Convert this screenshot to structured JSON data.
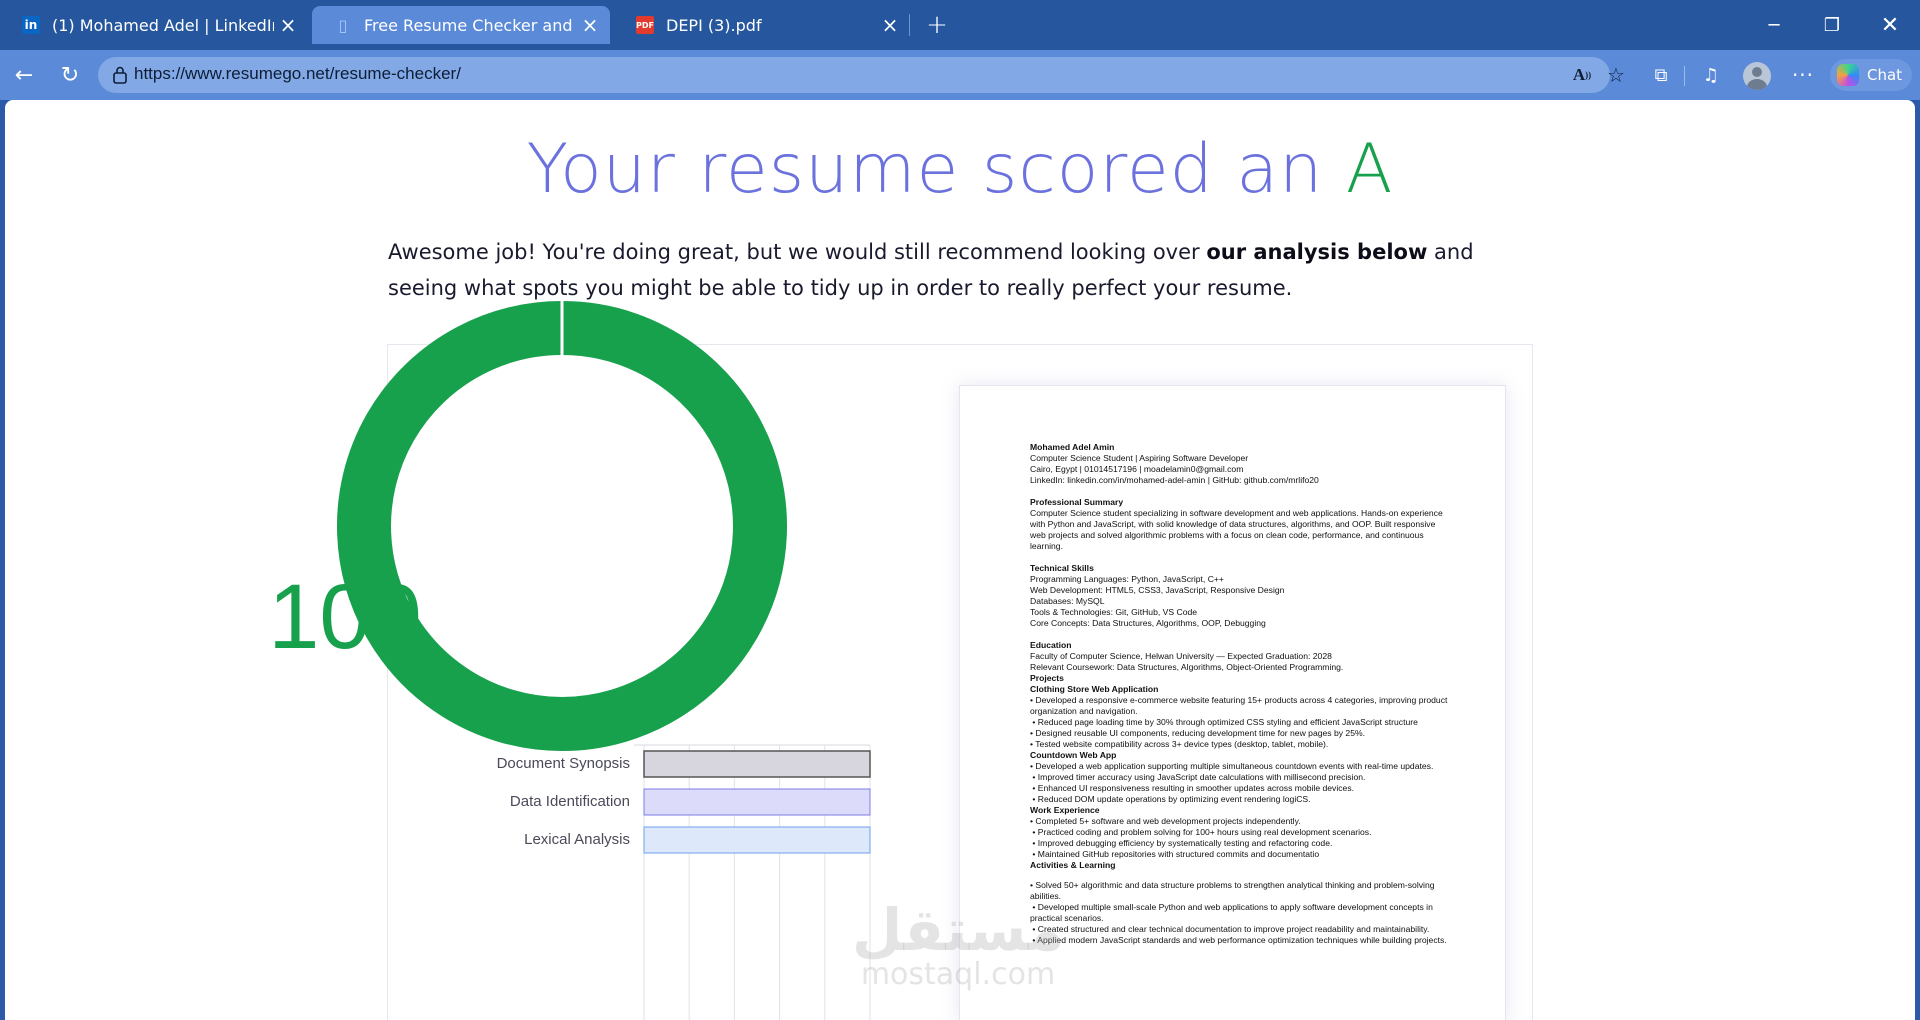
{
  "browser": {
    "tabs": [
      {
        "title": "(1) Mohamed Adel | LinkedIn",
        "icon": "linkedin-icon",
        "active": false
      },
      {
        "title": "Free Resume Checker and Scanner",
        "icon": "resumego-icon",
        "active": true
      },
      {
        "title": "DEPI (3).pdf",
        "icon": "pdf-icon",
        "active": false
      }
    ],
    "address_scheme": "https://",
    "address_host": "www.resumego.net",
    "address_path": "/resume-checker/",
    "chat_label": "Chat"
  },
  "page": {
    "headline": "Your resume scored an",
    "grade": "A",
    "intro_before": "Awesome job! You're doing great, but we would still recommend looking over ",
    "intro_bold": "our analysis below",
    "intro_after": " and seeing what spots you might be able to tidy up in order to really perfect your resume.",
    "score": "100",
    "score_value": 100,
    "colors": {
      "accent": "#6b72dd",
      "success": "#18a14c"
    },
    "bars": [
      {
        "label": "Document Synopsis",
        "fill": "#d7d6df",
        "stroke": "#555555"
      },
      {
        "label": "Data Identification",
        "fill": "#dcdcfa",
        "stroke": "#7b7be8"
      },
      {
        "label": "Lexical Analysis",
        "fill": "#dde9fb",
        "stroke": "#6aa0ee"
      }
    ]
  },
  "resume": {
    "name": "Mohamed Adel Amin",
    "headline": "Computer Science Student | Aspiring Software Developer",
    "contact": "Cairo, Egypt | 01014517196 | moadelamin0@gmail.com",
    "links": "LinkedIn: linkedin.com/in/mohamed-adel-amin | GitHub: github.com/mrlifo20",
    "summary_title": "Professional Summary",
    "summary": "Computer Science student specializing in software development and web applications. Hands-on experience with Python and JavaScript, with solid knowledge of data structures, algorithms, and OOP. Built responsive web projects and solved algorithmic problems with a focus on clean code, performance, and continuous learning.",
    "skills_title": "Technical Skills",
    "skills": [
      "Programming Languages: Python, JavaScript, C++",
      "Web Development: HTML5, CSS3, JavaScript, Responsive Design",
      "Databases: MySQL",
      "Tools & Technologies: Git, GitHub, VS Code",
      "Core Concepts: Data Structures, Algorithms, OOP, Debugging"
    ],
    "education_title": "Education",
    "education": [
      "Faculty of Computer Science, Helwan University — Expected Graduation: 2028",
      "Relevant Coursework: Data Structures, Algorithms, Object-Oriented Programming."
    ],
    "projects_title": "Projects",
    "project1_title": "Clothing Store Web Application",
    "project1": [
      "• Developed a responsive e-commerce website featuring 15+ products across 4 categories, improving product organization and navigation.",
      " • Reduced page loading time by 30% through optimized CSS styling and efficient JavaScript structure",
      "• Designed reusable UI components, reducing development time for new pages by 25%.",
      "• Tested website compatibility across 3+ device types (desktop, tablet, mobile)."
    ],
    "project2_title": "Countdown Web App",
    "project2": [
      "• Developed a web application supporting multiple simultaneous countdown events with real-time updates.",
      " • Improved timer accuracy using JavaScript date calculations with millisecond precision.",
      " • Enhanced UI responsiveness resulting in smoother updates across mobile devices.",
      " • Reduced DOM update operations by optimizing event rendering logiCS."
    ],
    "work_title": "Work Experience",
    "work": [
      "• Completed 5+ software and web development projects independently.",
      " • Practiced coding and problem solving for 100+ hours using real development scenarios.",
      " • Improved debugging efficiency by systematically testing and refactoring code.",
      " • Maintained GitHub repositories with structured commits and documentatio"
    ],
    "activities_title": "Activities & Learning",
    "activities": [
      "• Solved 50+ algorithmic and data structure problems to strengthen analytical thinking and problem-solving abilities.",
      " • Developed multiple small-scale Python and web applications to apply software development concepts in practical scenarios.",
      " • Created structured and clear technical documentation to improve project readability and maintainability.",
      " • Applied modern JavaScript standards and web performance optimization techniques while building projects."
    ]
  },
  "watermark": {
    "arabic": "مستقل",
    "latin": "mostaql.com"
  }
}
